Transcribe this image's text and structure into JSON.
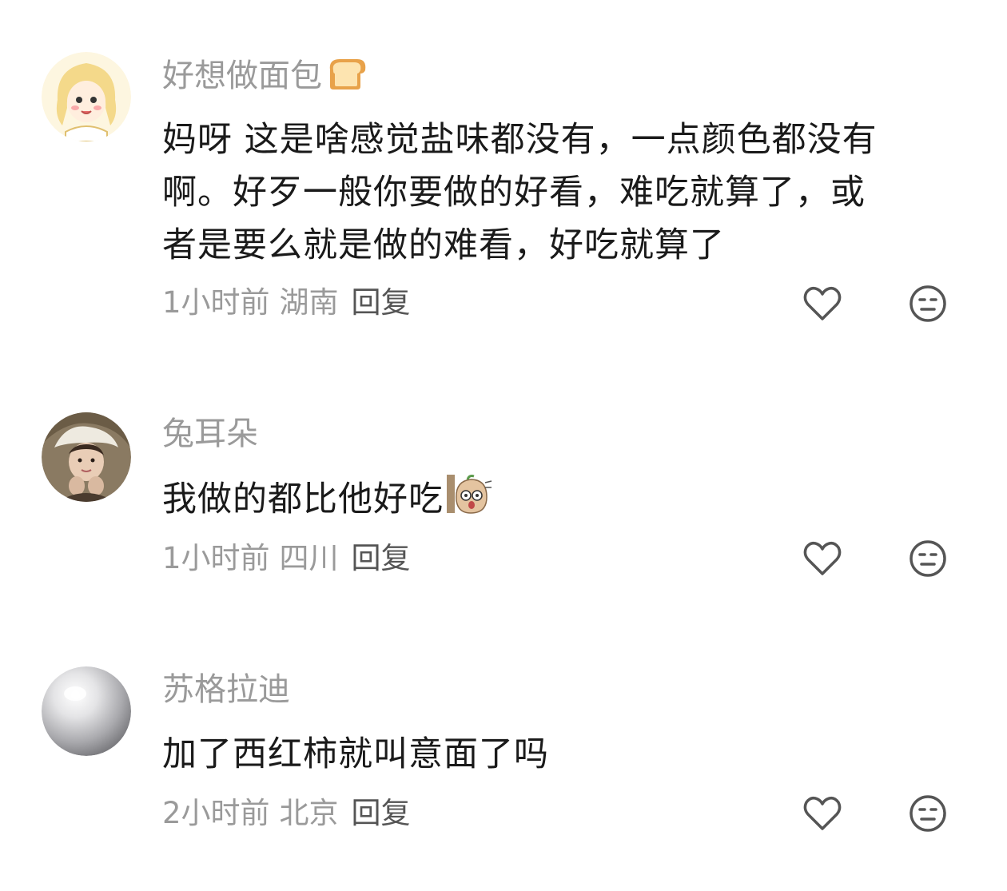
{
  "comments": [
    {
      "username": "好想做面包",
      "username_emoji": "bread-emoji",
      "text_lines": [
        "妈呀 这是啥感觉盐味都没有，一点颜色都没有",
        "啊。好歹一般你要做的好看，难吃就算了，或",
        "者是要么就是做的难看，好吃就算了"
      ],
      "time": "1小时前",
      "location": "湖南",
      "reply_label": "回复",
      "like_icon": "heart-outline-icon",
      "dislike_icon": "unamused-face-icon"
    },
    {
      "username": "兔耳朵",
      "text": "我做的都比他好吃",
      "text_sticker": "shocked-peanut-sticker",
      "time": "1小时前",
      "location": "四川",
      "reply_label": "回复",
      "like_icon": "heart-outline-icon",
      "dislike_icon": "unamused-face-icon"
    },
    {
      "username": "苏格拉迪",
      "text": "加了西红柿就叫意面了吗",
      "time": "2小时前",
      "location": "北京",
      "reply_label": "回复",
      "like_icon": "heart-outline-icon",
      "dislike_icon": "unamused-face-icon"
    }
  ],
  "colors": {
    "username": "#9a9a9a",
    "body_text": "#1a1a1a",
    "meta_text": "#9a9a9a",
    "icon_stroke": "#555555"
  }
}
